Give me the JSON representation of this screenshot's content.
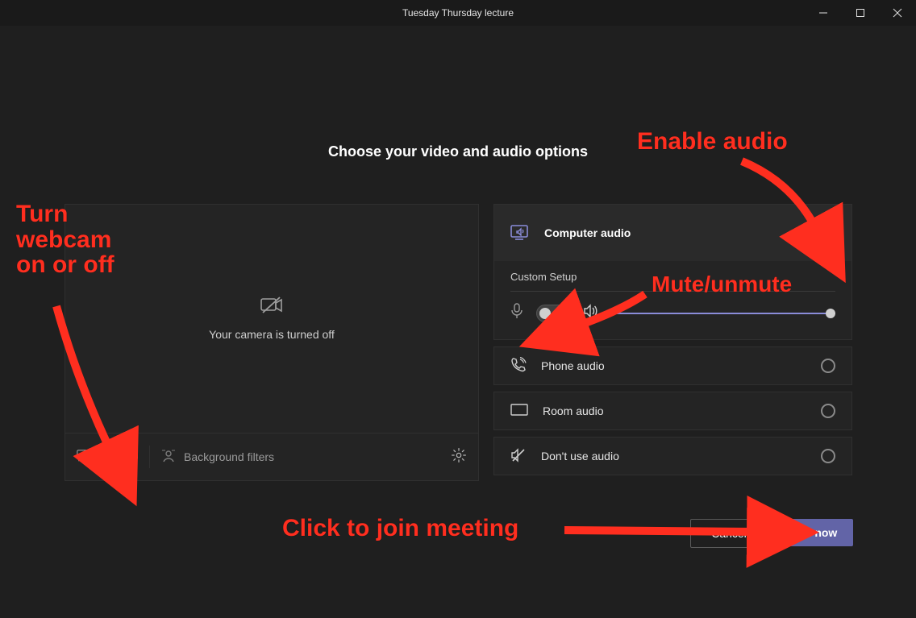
{
  "window": {
    "title": "Tuesday Thursday lecture"
  },
  "heading": "Choose your video and audio options",
  "video": {
    "camera_off_msg": "Your camera is turned off",
    "background_filters_label": "Background filters"
  },
  "audio": {
    "computer_audio_label": "Computer audio",
    "custom_setup_label": "Custom Setup",
    "phone_audio_label": "Phone audio",
    "room_audio_label": "Room audio",
    "dont_use_audio_label": "Don't use audio"
  },
  "footer": {
    "cancel_label": "Cancel",
    "join_label": "Join now"
  },
  "annotations": {
    "enable_audio": "Enable audio",
    "turn_webcam": "Turn\nwebcam\non or off",
    "mute_unmute": "Mute/unmute",
    "click_join": "Click to join meeting"
  }
}
